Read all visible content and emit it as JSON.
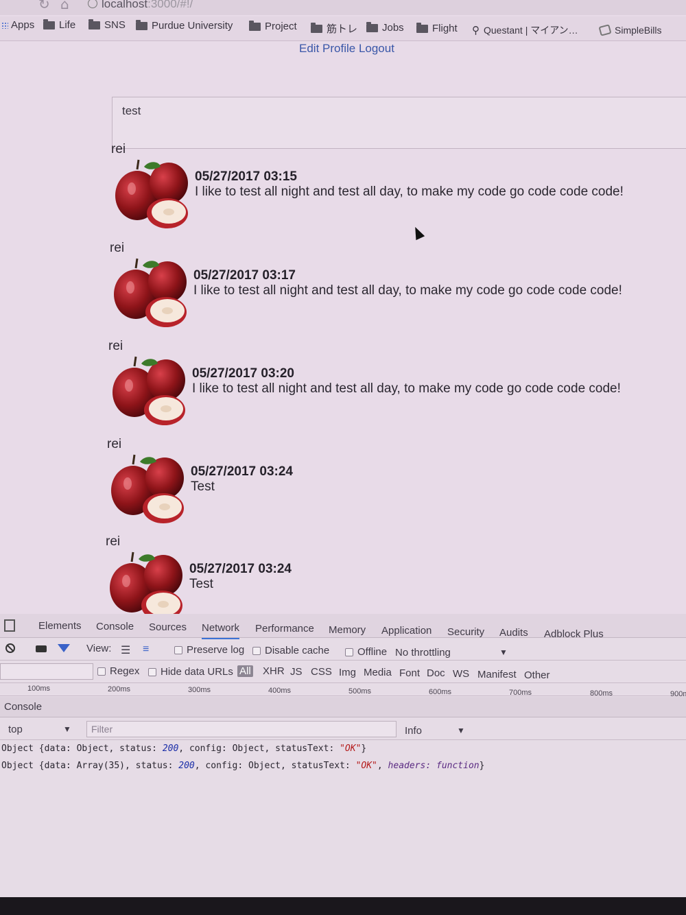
{
  "browser": {
    "url_host": "localhost",
    "url_rest": ":3000/#!/",
    "bookmarks": [
      {
        "label": "Apps",
        "icon": "apps-grid-icon"
      },
      {
        "label": "Life",
        "icon": "folder-icon"
      },
      {
        "label": "SNS",
        "icon": "folder-icon"
      },
      {
        "label": "Purdue University",
        "icon": "folder-icon"
      },
      {
        "label": "Project",
        "icon": "folder-icon"
      },
      {
        "label": "筋トレ",
        "icon": "folder-icon"
      },
      {
        "label": "Jobs",
        "icon": "folder-icon"
      },
      {
        "label": "Flight",
        "icon": "folder-icon"
      },
      {
        "label": "Questant | マイアン…",
        "icon": "pin-icon"
      },
      {
        "label": "SimpleBills",
        "icon": "simplebills-icon"
      }
    ]
  },
  "header": {
    "edit_profile": "Edit Profile",
    "logout": "Logout"
  },
  "composer": {
    "value": "test"
  },
  "posts": [
    {
      "user": "rei",
      "timestamp": "05/27/2017 03:15",
      "text": "I like to test all night and test all day, to make my code go code code code!"
    },
    {
      "user": "rei",
      "timestamp": "05/27/2017 03:17",
      "text": "I like to test all night and test all day, to make my code go code code code!"
    },
    {
      "user": "rei",
      "timestamp": "05/27/2017 03:20",
      "text": "I like to test all night and test all day, to make my code go code code code!"
    },
    {
      "user": "rei",
      "timestamp": "05/27/2017 03:24",
      "text": "Test"
    },
    {
      "user": "rei",
      "timestamp": "05/27/2017 03:24",
      "text": "Test"
    }
  ],
  "devtools": {
    "tabs": [
      "Elements",
      "Console",
      "Sources",
      "Network",
      "Performance",
      "Memory",
      "Application",
      "Security",
      "Audits",
      "Adblock Plus"
    ],
    "active_tab": "Network",
    "toolbar": {
      "view_label": "View:",
      "preserve_log": "Preserve log",
      "disable_cache": "Disable cache",
      "offline": "Offline",
      "throttling": "No throttling"
    },
    "filter_types": {
      "regex": "Regex",
      "hide_data_urls": "Hide data URLs",
      "types": [
        "All",
        "XHR",
        "JS",
        "CSS",
        "Img",
        "Media",
        "Font",
        "Doc",
        "WS",
        "Manifest",
        "Other"
      ]
    },
    "timeline_ticks": [
      "100ms",
      "200ms",
      "300ms",
      "400ms",
      "500ms",
      "600ms",
      "700ms",
      "800ms",
      "900ms"
    ],
    "console": {
      "tab_label": "Console",
      "context": "top",
      "filter_placeholder": "Filter",
      "level": "Info",
      "logs": [
        {
          "p1": "Object {data: Object, status: ",
          "n1": "200",
          "p2": ", config: Object, statusText: ",
          "s1": "\"OK\"",
          "p3": "}",
          "k1": "",
          "p4": ""
        },
        {
          "p1": "Object {data: Array(35), status: ",
          "n1": "200",
          "p2": ", config: Object, statusText: ",
          "s1": "\"OK\"",
          "p3": ", ",
          "k1": "headers: function",
          "p4": "}"
        }
      ]
    }
  }
}
